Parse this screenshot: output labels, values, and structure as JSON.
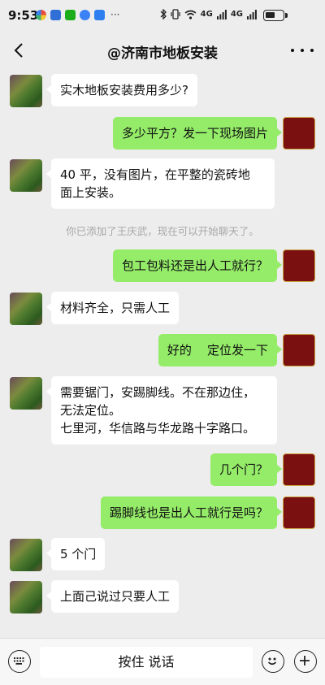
{
  "status_bar": {
    "time": "9:53",
    "network": "4G",
    "network2": "4G"
  },
  "header": {
    "title": "@济南市地板安装"
  },
  "messages": [
    {
      "side": "left",
      "text": "实木地板安装费用多少?"
    },
    {
      "side": "right",
      "text": "多少平方？发一下现场图片"
    },
    {
      "side": "left",
      "text": "40 平，没有图片，在平整的瓷砖地\n面上安装。"
    },
    {
      "side": "system",
      "text": "你已添加了王庆武，现在可以开始聊天了。"
    },
    {
      "side": "right",
      "text": "包工包料还是出人工就行？"
    },
    {
      "side": "left",
      "text": "材料齐全，只需人工"
    },
    {
      "side": "right",
      "text": "好的    定位发一下"
    },
    {
      "side": "left",
      "text": "需要锯门，安踢脚线。不在那边住，\n无法定位。\n七里河，华信路与华龙路十字路口。"
    },
    {
      "side": "right",
      "text": "几个门？"
    },
    {
      "side": "right",
      "text": "踢脚线也是出人工就行是吗？"
    },
    {
      "side": "left",
      "text": "5 个门"
    },
    {
      "side": "left",
      "text": "上面己说过只要人工"
    }
  ],
  "input_bar": {
    "hold_to_talk": "按住 说话"
  }
}
